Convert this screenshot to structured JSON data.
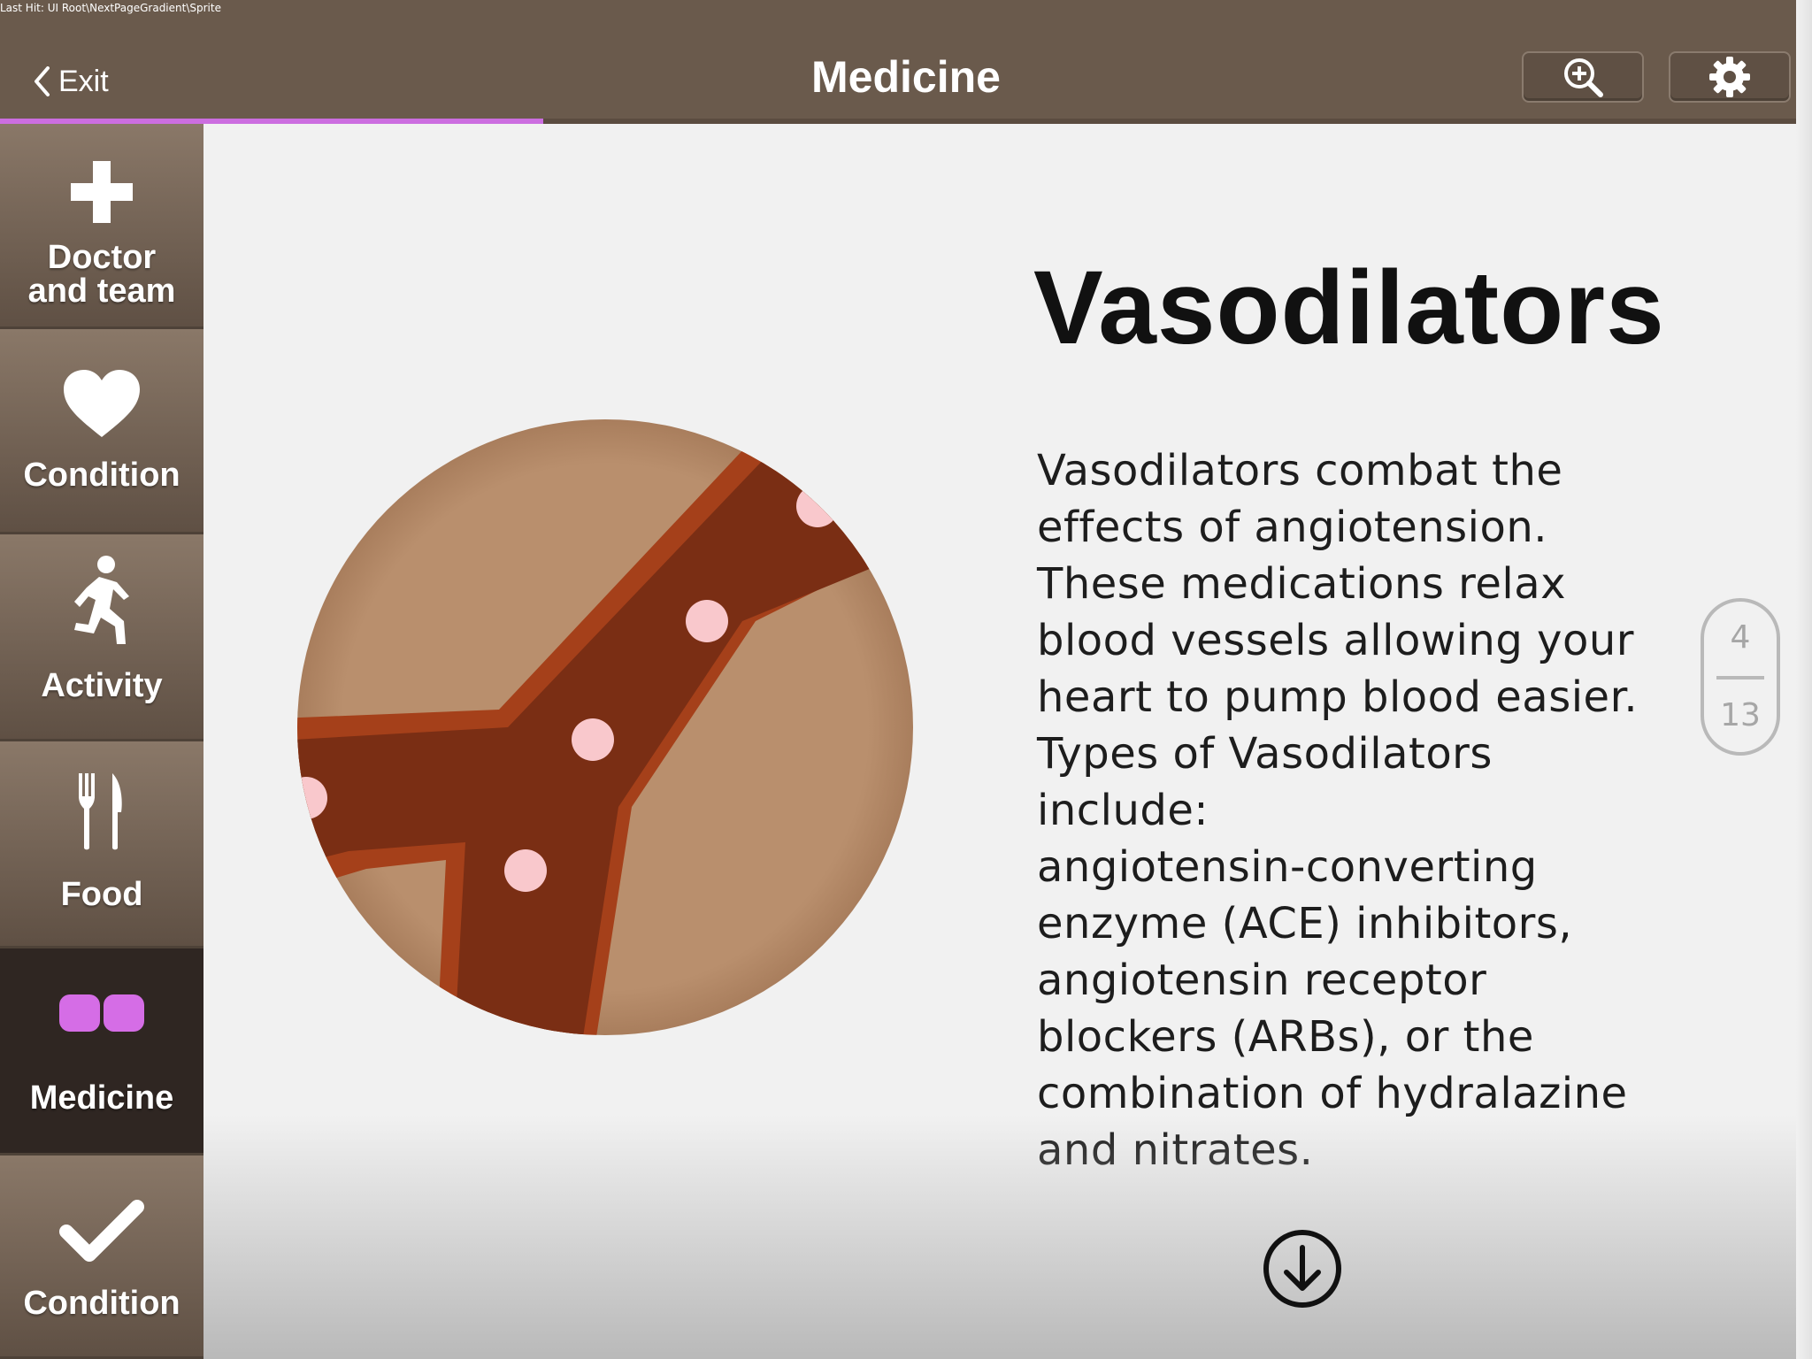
{
  "debug": "Last Hit: UI Root\\NextPageGradient\\Sprite",
  "header": {
    "exit_label": "Exit",
    "title": "Medicine",
    "progress_fraction": 0.3
  },
  "sidebar": {
    "items": [
      {
        "label": "Doctor\nand team",
        "icon": "plus-icon"
      },
      {
        "label": "Condition",
        "icon": "heart-icon"
      },
      {
        "label": "Activity",
        "icon": "running-person-icon"
      },
      {
        "label": "Food",
        "icon": "fork-knife-icon"
      },
      {
        "label": "Medicine",
        "icon": "pill-icon",
        "active": true
      },
      {
        "label": "Condition",
        "icon": "checkmark-icon"
      }
    ]
  },
  "article": {
    "title": "Vasodilators",
    "body": "Vasodilators combat the\neffects of angiotension.\n These medications relax\nblood vessels allowing your\nheart to pump blood easier.\n Types of Vasodilators\ninclude:\nangiotensin-converting\nenzyme (ACE) inhibitors,\nangiotensin receptor\nblockers (ARBs), or the\ncombination of hydralazine\nand nitrates."
  },
  "pager": {
    "current": "4",
    "total": "13"
  },
  "colors": {
    "topbar": "#6a5a4c",
    "accent": "#cc6ee0",
    "sidebar_active": "#2f2622",
    "vessel": "#7a2e14",
    "tissue": "#b98f6d"
  }
}
